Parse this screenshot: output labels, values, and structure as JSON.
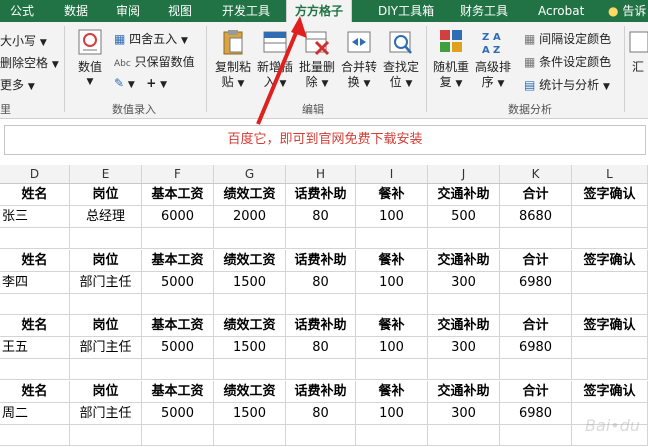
{
  "tabs": [
    "公式",
    "数据",
    "审阅",
    "视图",
    "开发工具",
    "方方格子",
    "DIY工具箱",
    "财务工具",
    "Acrobat",
    "告诉"
  ],
  "ribbon": {
    "left_items": [
      "大小写",
      "删除空格",
      "更多"
    ],
    "numbers_btn": "数值",
    "round_btn": "四舍五入",
    "keep_value_btn": "只保留数值",
    "copy_paste_btn": [
      "复制粘",
      "贴"
    ],
    "insert_btn": [
      "新增插",
      "入"
    ],
    "batch_delete_btn": [
      "批量删",
      "除"
    ],
    "merge_convert_btn": [
      "合并转",
      "换"
    ],
    "find_locate_btn": [
      "查找定",
      "位"
    ],
    "random_btn": [
      "随机重",
      "复"
    ],
    "sort_btn": [
      "高级排",
      "序"
    ],
    "interval_color": "间隔设定颜色",
    "cond_color": "条件设定颜色",
    "stats_btn": "统计与分析",
    "right_partial": "汇",
    "group_labels": [
      "数值录入",
      "编辑",
      "数据分析"
    ],
    "left_group_tail": "里"
  },
  "formula_note": "百度它，即可到官网免费下载安装",
  "column_letters": [
    "D",
    "E",
    "F",
    "G",
    "H",
    "I",
    "J",
    "K",
    "L"
  ],
  "blocks": [
    {
      "header": [
        "姓名",
        "岗位",
        "基本工资",
        "绩效工资",
        "话费补助",
        "餐补",
        "交通补助",
        "合计",
        "签字确认"
      ],
      "row": [
        "张三",
        "总经理",
        "6000",
        "2000",
        "80",
        "100",
        "500",
        "8680",
        ""
      ]
    },
    {
      "header": [
        "姓名",
        "岗位",
        "基本工资",
        "绩效工资",
        "话费补助",
        "餐补",
        "交通补助",
        "合计",
        "签字确认"
      ],
      "row": [
        "李四",
        "部门主任",
        "5000",
        "1500",
        "80",
        "100",
        "300",
        "6980",
        ""
      ]
    },
    {
      "header": [
        "姓名",
        "岗位",
        "基本工资",
        "绩效工资",
        "话费补助",
        "餐补",
        "交通补助",
        "合计",
        "签字确认"
      ],
      "row": [
        "王五",
        "部门主任",
        "5000",
        "1500",
        "80",
        "100",
        "300",
        "6980",
        ""
      ]
    },
    {
      "header": [
        "姓名",
        "岗位",
        "基本工资",
        "绩效工资",
        "话费补助",
        "餐补",
        "交通补助",
        "合计",
        "签字确认"
      ],
      "row": [
        "周二",
        "部门主任",
        "5000",
        "1500",
        "80",
        "100",
        "300",
        "6980",
        ""
      ]
    }
  ],
  "colors": {
    "excel_green": "#217346",
    "note_red": "#d23c34",
    "arrow_red": "#e02020"
  }
}
